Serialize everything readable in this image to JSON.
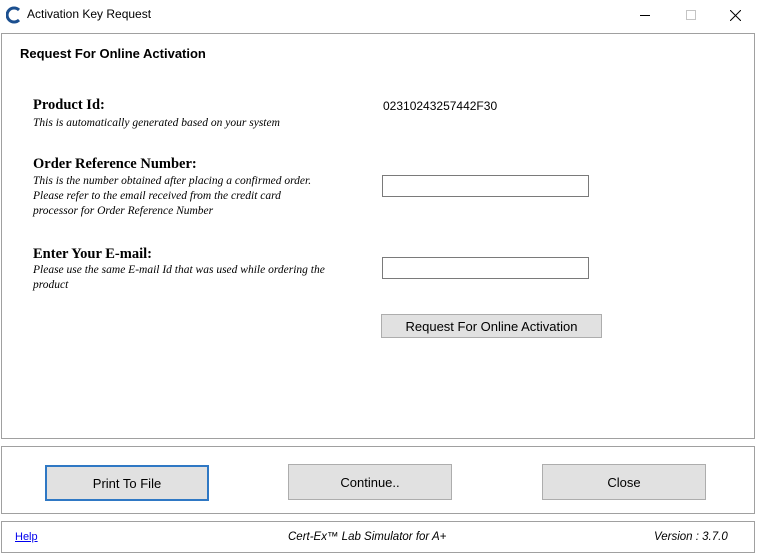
{
  "window": {
    "title": "Activation Key Request",
    "controls": {
      "minimize": "—",
      "maximize": "☐",
      "close": "✕"
    }
  },
  "main": {
    "section_title": "Request For Online Activation",
    "product_id": {
      "label": "Product Id:",
      "description": "This is automatically generated based on your system",
      "value": "02310243257442F30"
    },
    "order_ref": {
      "label": "Order Reference Number:",
      "description_lines": [
        "This is the number obtained after placing a confirmed order.",
        "Please refer to the email received from the credit card",
        "processor for Order Reference Number"
      ],
      "value": ""
    },
    "email": {
      "label": "Enter Your E-mail:",
      "description_lines": [
        "Please use the same E-mail Id that was used while ordering the",
        "product"
      ],
      "value": ""
    },
    "activation_button": "Request For Online Activation"
  },
  "buttons": {
    "print": "Print To File",
    "continue": "Continue..",
    "close": "Close"
  },
  "status": {
    "help": "Help",
    "product": "Cert-Ex™ Lab Simulator for A+",
    "version": "Version : 3.7.0"
  },
  "colors": {
    "accent": "#2f78c4",
    "button_bg": "#e1e1e1",
    "link": "#0000ee"
  }
}
